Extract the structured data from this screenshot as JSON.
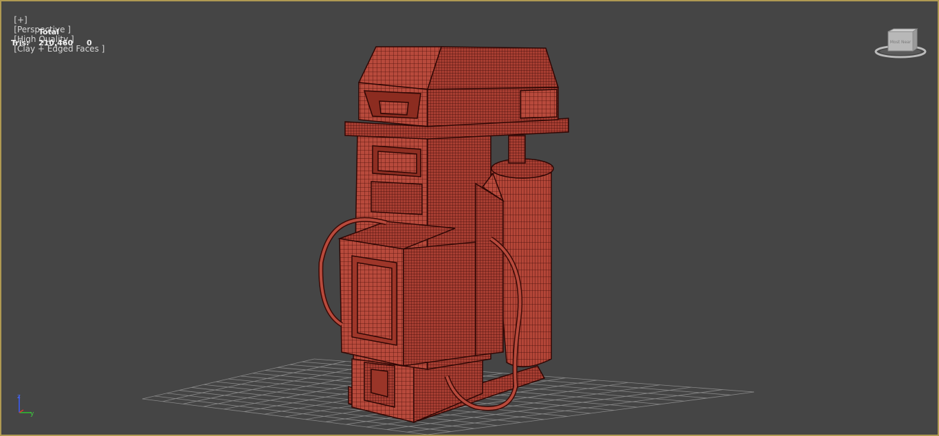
{
  "viewport": {
    "labels": [
      "[+]",
      "[Perspective ]",
      "[High Quality ]",
      "[Clay + Edged Faces ]"
    ],
    "stats": {
      "total_header": "Total",
      "tris_label": "Tris:",
      "tris_total": "210,460",
      "tris_selected": "0"
    },
    "axes": {
      "z": "z",
      "y": "y"
    },
    "viewcube_text": "Most Near",
    "colors": {
      "background": "#454545",
      "border": "#b09a52",
      "model_fill": "#b84a3c",
      "model_edge": "#3a0a06",
      "grid": "#8a8a8a"
    }
  }
}
